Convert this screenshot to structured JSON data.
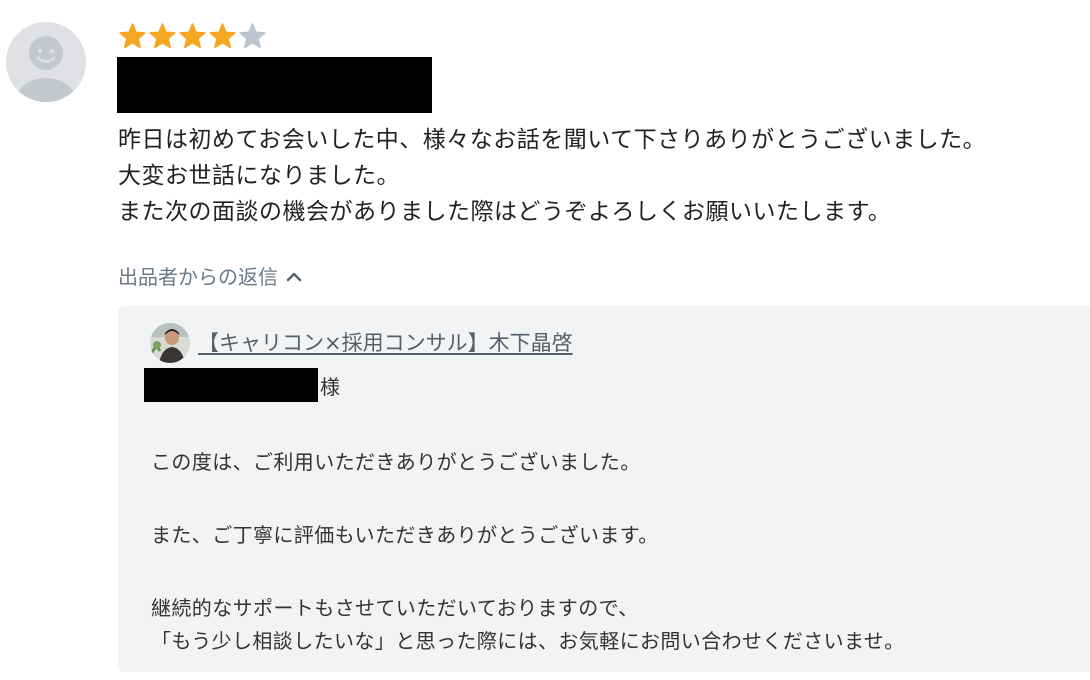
{
  "review": {
    "rating": 4,
    "max_rating": 5,
    "colors": {
      "star_filled": "#f5a623",
      "star_empty": "#bcc5cd"
    },
    "icons": {
      "avatar": "default-user-avatar",
      "star": "star-icon"
    },
    "lines": [
      "昨日は初めてお会いした中、様々なお話を聞いて下さりありがとうございました。",
      "大変お世話になりました。",
      "また次の面談の機会がありました際はどうぞよろしくお願いいたします。"
    ]
  },
  "reply_toggle": {
    "label": "出品者からの返信",
    "icon": "chevron-up-icon"
  },
  "reply": {
    "seller_name": "【キャリコン×採用コンサル】木下晶啓",
    "honorific": "様",
    "paragraphs": [
      "この度は、ご利用いただきありがとうございました。",
      "また、ご丁寧に評価もいただきありがとうございます。",
      "継続的なサポートもさせていただいておりますので、",
      "「もう少し相談したいな」と思った際には、お気軽にお問い合わせくださいませ。"
    ],
    "colors": {
      "background": "#f2f3f5",
      "link": "#55606b"
    }
  }
}
